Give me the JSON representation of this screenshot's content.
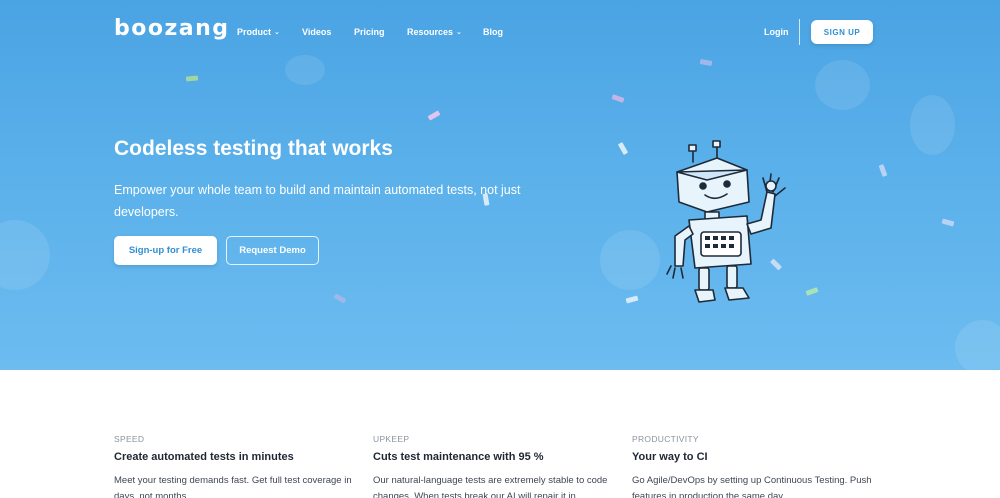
{
  "brand": {
    "logo": "boozang"
  },
  "nav": {
    "items": [
      {
        "label": "Product",
        "has_dropdown": true
      },
      {
        "label": "Videos",
        "has_dropdown": false
      },
      {
        "label": "Pricing",
        "has_dropdown": false
      },
      {
        "label": "Resources",
        "has_dropdown": true
      },
      {
        "label": "Blog",
        "has_dropdown": false
      }
    ],
    "login": "Login",
    "signup": "SIGN UP"
  },
  "hero": {
    "headline": "Codeless testing that works",
    "subline": "Empower your whole team to build and maintain automated tests, not just developers.",
    "primary_cta": "Sign-up for Free",
    "secondary_cta": "Request Demo"
  },
  "features": [
    {
      "eyebrow": "SPEED",
      "title": "Create automated tests in minutes",
      "body": "Meet your testing demands fast. Get full test coverage in days, not months."
    },
    {
      "eyebrow": "UPKEEP",
      "title": "Cuts test maintenance with 95 %",
      "body": "Our natural-language tests are extremely stable to code changes. When tests break our AI will repair it in"
    },
    {
      "eyebrow": "PRODUCTIVITY",
      "title": "Your way to CI",
      "body": "Go Agile/DevOps by setting up Continuous Testing. Push features in production the same day."
    }
  ],
  "colors": {
    "hero_top": "#4aa3e3",
    "hero_bottom": "#6cbcf0",
    "accent": "#2f8fd6",
    "heading_dark": "#1f2733",
    "muted": "#8a93a0"
  }
}
